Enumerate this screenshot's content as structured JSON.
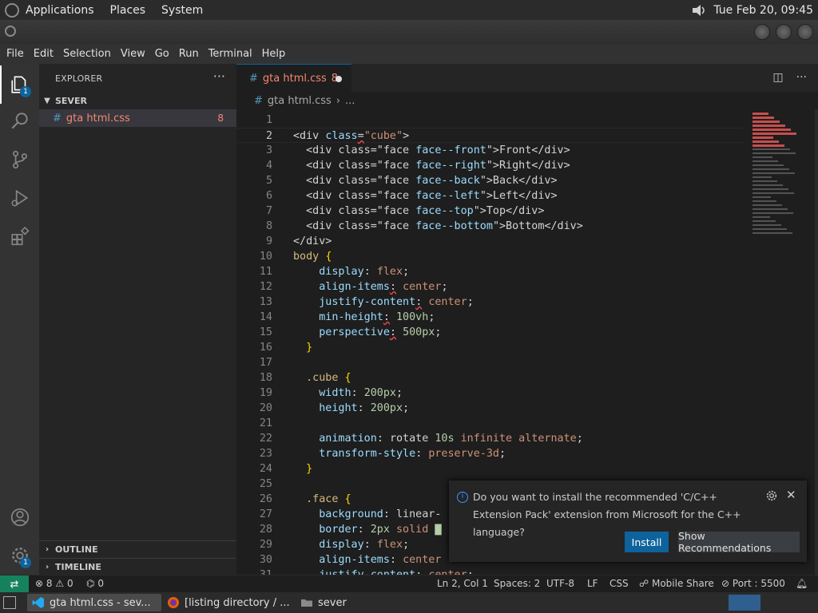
{
  "system_bar": {
    "menus": [
      "Applications",
      "Places",
      "System"
    ],
    "datetime": "Tue Feb 20, 09:45"
  },
  "menubar": [
    "File",
    "Edit",
    "Selection",
    "View",
    "Go",
    "Run",
    "Terminal",
    "Help"
  ],
  "activity": {
    "explorer_badge": "1",
    "account_badge": "1"
  },
  "sidebar": {
    "title": "EXPLORER",
    "more": "···",
    "folder": "SEVER",
    "file_name": "gta html.css",
    "file_problems": "8",
    "outline": "OUTLINE",
    "timeline": "TIMELINE"
  },
  "tab": {
    "name": "gta html.css",
    "problems": "8"
  },
  "breadcrumb": {
    "file": "gta html.css",
    "sep": "›",
    "rest": "..."
  },
  "code": {
    "current_line": 2,
    "lines": [
      {
        "n": "1",
        "html": ""
      },
      {
        "n": "2",
        "html": "<span class='t-tag'>&lt;div </span><span class='t-prop'>class</span><span class='t-tag squig'>=</span><span class='t-str'>\"cube\"</span><span class='t-tag'>&gt;</span>"
      },
      {
        "n": "3",
        "html": "  <span class='t-tag'>&lt;div class=\"face </span><span class='t-prop'>face--front</span><span class='t-tag'>\"&gt;Front&lt;/div&gt;</span>"
      },
      {
        "n": "4",
        "html": "  <span class='t-tag'>&lt;div class=\"face </span><span class='t-prop'>face--right</span><span class='t-tag'>\"&gt;Right&lt;/div&gt;</span>"
      },
      {
        "n": "5",
        "html": "  <span class='t-tag'>&lt;div class=\"face </span><span class='t-prop'>face--back</span><span class='t-tag'>\"&gt;Back&lt;/div&gt;</span>"
      },
      {
        "n": "6",
        "html": "  <span class='t-tag'>&lt;div class=\"face </span><span class='t-prop'>face--left</span><span class='t-tag'>\"&gt;Left&lt;/div&gt;</span>"
      },
      {
        "n": "7",
        "html": "  <span class='t-tag'>&lt;div class=\"face </span><span class='t-prop'>face--top</span><span class='t-tag'>\"&gt;Top&lt;/div&gt;</span>"
      },
      {
        "n": "8",
        "html": "  <span class='t-tag'>&lt;div class=\"face </span><span class='t-prop'>face--bottom</span><span class='t-tag'>\"&gt;Bottom&lt;/div&gt;</span>"
      },
      {
        "n": "9",
        "html": "<span class='t-tag'>&lt;/div&gt;</span>"
      },
      {
        "n": "10",
        "html": "<span class='t-sel'>body</span> <span class='t-brace'>{</span>"
      },
      {
        "n": "11",
        "html": "    <span class='t-prop'>display</span>: <span class='t-val'>flex</span>;"
      },
      {
        "n": "12",
        "html": "    <span class='t-prop'>align-items</span><span class='squig'>:</span> <span class='t-val'>center</span>;"
      },
      {
        "n": "13",
        "html": "    <span class='t-prop'>justify-content</span><span class='squig'>:</span> <span class='t-val'>center</span>;"
      },
      {
        "n": "14",
        "html": "    <span class='t-prop'>min-height</span><span class='squig'>:</span> <span class='t-num'>100vh</span>;"
      },
      {
        "n": "15",
        "html": "    <span class='t-prop'>perspective</span><span class='squig'>:</span> <span class='t-num'>500px</span>;"
      },
      {
        "n": "16",
        "html": "  <span class='t-brace'>}</span>"
      },
      {
        "n": "17",
        "html": ""
      },
      {
        "n": "18",
        "html": "  <span class='t-sel'>.cube</span> <span class='t-brace'>{</span>"
      },
      {
        "n": "19",
        "html": "    <span class='t-prop'>width</span>: <span class='t-num'>200px</span>;"
      },
      {
        "n": "20",
        "html": "    <span class='t-prop'>height</span>: <span class='t-num'>200px</span>;"
      },
      {
        "n": "21",
        "html": ""
      },
      {
        "n": "22",
        "html": "    <span class='t-prop'>animation</span>: <span class='t-tag'>rotate</span> <span class='t-num'>10s</span> <span class='t-val'>infinite alternate</span>;"
      },
      {
        "n": "23",
        "html": "    <span class='t-prop'>transform-style</span>: <span class='t-val'>preserve-3d</span>;"
      },
      {
        "n": "24",
        "html": "  <span class='t-brace'>}</span>"
      },
      {
        "n": "25",
        "html": ""
      },
      {
        "n": "26",
        "html": "  <span class='t-sel'>.face</span> <span class='t-brace'>{</span>"
      },
      {
        "n": "27",
        "html": "    <span class='t-prop'>background</span>: <span class='t-tag'>linear-</span>"
      },
      {
        "n": "28",
        "html": "    <span class='t-prop'>border</span>: <span class='t-num'>2px</span> <span class='t-val'>solid</span> <span style='color:#b5cea8'>▇</span>"
      },
      {
        "n": "29",
        "html": "    <span class='t-prop'>display</span>: <span class='t-val'>flex</span>;"
      },
      {
        "n": "30",
        "html": "    <span class='t-prop'>align-items</span>: <span class='t-val'>center</span>"
      },
      {
        "n": "31",
        "html": "    <span class='t-prop'>justify-content</span>: <span class='t-val'>center</span>;"
      }
    ]
  },
  "notification": {
    "message": "Do you want to install the recommended 'C/C++ Extension Pack' extension from Microsoft for the C++ language?",
    "install": "Install",
    "show_recommendations": "Show Recommendations"
  },
  "statusbar": {
    "errors": "8",
    "warnings": "0",
    "ports": "0",
    "position": "Ln 2, Col 1",
    "spaces": "Spaces: 2",
    "encoding": "UTF-8",
    "eol": "LF",
    "language": "CSS",
    "mobile_share": "Mobile Share",
    "port": "Port : 5500"
  },
  "taskbar": {
    "item1": "gta html.css - sev...",
    "item2": "[listing directory / ...",
    "item3": "sever"
  }
}
